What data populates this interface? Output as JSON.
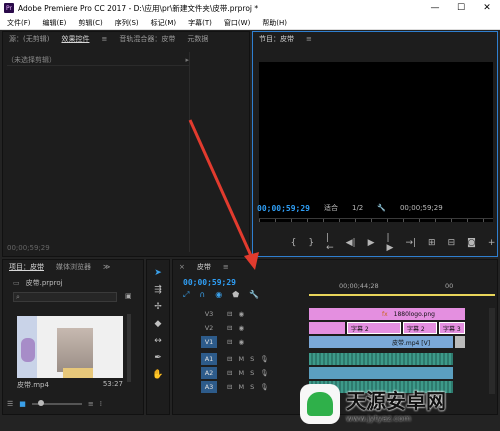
{
  "titlebar": {
    "title": "Adobe Premiere Pro CC 2017 - D:\\应用\\pr\\新建文件夹\\皮带.prproj *",
    "logo": "Pr"
  },
  "window_buttons": [
    "—",
    "☐",
    "✕"
  ],
  "menu": [
    "文件(F)",
    "编辑(E)",
    "剪辑(C)",
    "序列(S)",
    "标记(M)",
    "字幕(T)",
    "窗口(W)",
    "帮助(H)"
  ],
  "source_panel": {
    "tabs": [
      "源：(无剪辑)",
      "效果控件",
      "音轨混合器：皮带",
      "元数据"
    ],
    "menu_icon": "≡",
    "active_tab": 1,
    "no_clip": "（未选择剪辑）",
    "timecode": "00;00;59;29"
  },
  "program_panel": {
    "title": "节目：皮带",
    "menu_icon": "≡",
    "timecode_left": "00;00;59;29",
    "fit": "适合",
    "quality": "1/2",
    "timecode_right": "00;00;59;29",
    "controls": [
      "{",
      "}",
      "|←",
      "◀|",
      "▶",
      "|▶",
      "→|",
      "⊞",
      "⊟",
      "◙",
      "+"
    ]
  },
  "project_panel": {
    "tabs": [
      "项目：皮带",
      "媒体浏览器"
    ],
    "expand": "≫",
    "file": "皮带.prproj",
    "search_placeholder": "",
    "clip_name": "皮带.mp4",
    "clip_duration": "53:27"
  },
  "timeline": {
    "close": "×",
    "title": "皮带",
    "timecode": "00;00;59;29",
    "ruler": [
      "00;00;44;28",
      "00"
    ],
    "video_tracks": [
      {
        "name": "V3",
        "active": false
      },
      {
        "name": "V2",
        "active": false
      },
      {
        "name": "V1",
        "active": true
      }
    ],
    "audio_tracks": [
      {
        "name": "A1",
        "active": true
      },
      {
        "name": "A2",
        "active": true
      },
      {
        "name": "A3",
        "active": true
      }
    ],
    "audio_toggles": [
      "M",
      "S"
    ],
    "clips": {
      "v3": "1880logo.png",
      "v2a": "字幕 2",
      "v2b": "字幕 2",
      "v2c": "字幕 3",
      "v1": "皮带.mp4 [V]"
    }
  },
  "colors": {
    "accent": "#2f9ef5",
    "clip_pink": "#e48fe0",
    "clip_blue": "#7aa8d8",
    "audio_green": "#3d9a8a",
    "arrow": "#e23b2e"
  },
  "watermark": {
    "name": "天源安卓网",
    "url": "www.jytyaz.com"
  }
}
